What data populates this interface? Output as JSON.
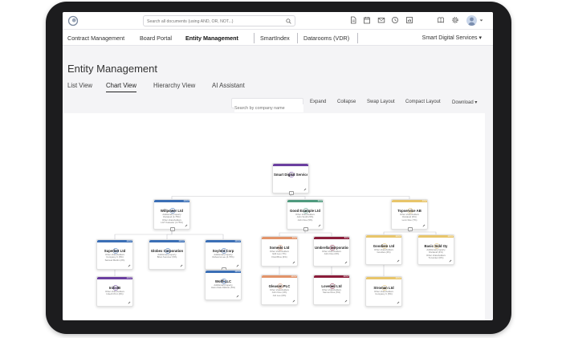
{
  "header": {
    "search_placeholder": "Search all documents (using AND, OR, NOT...)",
    "icons": [
      "document-icon",
      "calendar-icon",
      "mail-icon",
      "history-icon",
      "report-icon",
      "book-icon",
      "gear-icon",
      "avatar",
      "chevron-down-icon"
    ]
  },
  "nav": {
    "items": [
      "Contract Management",
      "Board Portal",
      "Entity Management",
      "SmartIndex",
      "Datarooms (VDR)"
    ],
    "active": "Entity Management",
    "workspace": "Smart Digital Services",
    "caret": "▾"
  },
  "page": {
    "title": "Entity Management",
    "tabs": [
      "List View",
      "Chart View",
      "Hierarchy View",
      "AI Assistant"
    ],
    "active_tab": "Chart View"
  },
  "toolbar": {
    "search_placeholder": "Search by company name",
    "expand": "Expand",
    "collapse": "Collapse",
    "swap_layout": "Swap Layout",
    "compact_layout": "Compact Layout",
    "download": "Download",
    "download_caret": "▾"
  },
  "colors": {
    "purple": "#6b3fa0",
    "blue": "#3b6fb6",
    "green": "#4f9a7e",
    "yellow": "#e8c56a",
    "orange": "#e2946a",
    "crimson": "#8b1d3a"
  },
  "nodes": [
    {
      "id": "root",
      "title": "Smart Digital Services",
      "sub": "",
      "color": "purple",
      "expander": "−"
    },
    {
      "id": "willpower",
      "title": "Willpower Ltd",
      "sub": "Additional property\nDividend (4.75%)\nOther shareholders\nLGT Kasseler (4.75%)",
      "color": "blue",
      "expander": "−",
      "pct": "100%"
    },
    {
      "id": "good",
      "title": "Good Example Ltd",
      "sub": "Other shareholders\nJohn Smith (5%)\nJohn Doe (5%)",
      "color": "green",
      "expander": "−",
      "pct": "60%"
    },
    {
      "id": "topservice",
      "title": "Topservice AB",
      "sub": "Other shareholders\nDividend (6%)\nLenn Doe (7%)",
      "color": "yellow",
      "expander": "−",
      "pct": "40%"
    },
    {
      "id": "superbet",
      "title": "Superbet Ltd",
      "sub": "Other shareholders\nCompany C (5%)\nSamuel Martin (2%)",
      "color": "blue",
      "pct": "100%"
    },
    {
      "id": "globex",
      "title": "Globex Corporation",
      "sub": "Additional property\nBrian Summer (5%)",
      "color": "blue",
      "pct": "100%"
    },
    {
      "id": "soylent",
      "title": "Soylent Corp",
      "sub": "Additional property\nRebecca Lee (4.75%)",
      "color": "blue",
      "expander": "−",
      "pct": "100%"
    },
    {
      "id": "initech",
      "title": "Initi 3B",
      "sub": "Other shareholders\nInitech PLC (6%)",
      "color": "purple",
      "pct": "100%"
    },
    {
      "id": "wolff",
      "title": "Wolff LLC",
      "sub": "Additional property\nHans Dale Dalimlo (6%)",
      "color": "blue",
      "pct": "100%"
    },
    {
      "id": "somedo",
      "title": "Somedo Ltd",
      "sub": "Other shareholders\nEdit Lee (7%)\nFluid Bros (6%)",
      "color": "orange",
      "pct": "90%"
    },
    {
      "id": "umbrella",
      "title": "Umbrella Corporation",
      "sub": "Other shareholders\nJohn Doe (6%)",
      "color": "crimson",
      "pct": "80%"
    },
    {
      "id": "goodiem",
      "title": "Goodiem Ltd",
      "sub": "Other shareholders\nGoodies (4%)",
      "color": "yellow",
      "pct": "100%"
    },
    {
      "id": "basic",
      "title": "Basic Sold Oy",
      "sub": "Additional property\nDividend (4%)\nOther shareholders\nTo Hunter (6%)",
      "color": "yellow",
      "pct": "100%"
    },
    {
      "id": "gleason",
      "title": "Gleason PLC",
      "sub": "Other shareholders\nJohn Doe (4%)\nJob Lee (6%)",
      "color": "orange",
      "pct": "100%"
    },
    {
      "id": "lovemel",
      "title": "Lovemel Ltd",
      "sub": "Other shareholders\nSamuel Doe (5%)",
      "color": "crimson",
      "pct": "100%"
    },
    {
      "id": "stroman",
      "title": "Stroman Ltd",
      "sub": "Other shareholders\nCompany C (5%)",
      "color": "yellow",
      "pct": "100%"
    }
  ]
}
